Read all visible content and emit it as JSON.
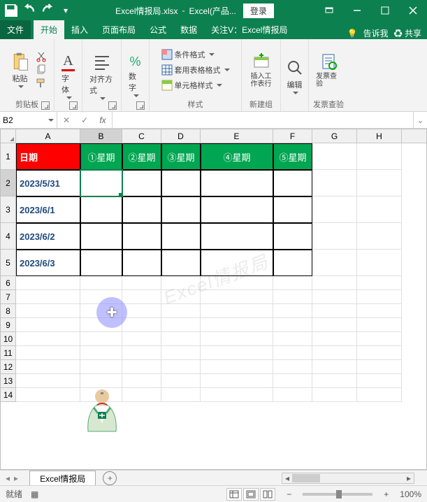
{
  "title_bar": {
    "filename": "Excel情报局.xlsx",
    "app": "Excel(产品...",
    "login": "登录"
  },
  "ribbon": {
    "tabs": {
      "file": "文件",
      "home": "开始",
      "insert": "插入",
      "layout": "页面布局",
      "formula": "公式",
      "data": "数据",
      "follow": "关注V：Excel情报局",
      "tellme": "告诉我",
      "share": "共享"
    },
    "groups": {
      "clipboard": {
        "label": "剪贴板",
        "paste": "粘贴"
      },
      "font": {
        "label": "字体"
      },
      "align": {
        "label": "对齐方式"
      },
      "number": {
        "label": "数字"
      },
      "styles": {
        "label": "样式",
        "cond": "条件格式",
        "table": "套用表格格式",
        "cell": "单元格样式"
      },
      "newgroup": {
        "label": "新建组",
        "insert_ws": "插入工作表行"
      },
      "editing": {
        "label": "编辑"
      },
      "invoice": {
        "label": "发票查验",
        "btn": "发票查验"
      }
    }
  },
  "namebox": "B2",
  "columns": [
    "A",
    "B",
    "C",
    "D",
    "E",
    "F",
    "G",
    "H"
  ],
  "table": {
    "headers": {
      "date": "日期",
      "w1": "①星期",
      "w2": "②星期",
      "w3": "③星期",
      "w4": "④星期",
      "w5": "⑤星期"
    },
    "rows": [
      {
        "date": "2023/5/31"
      },
      {
        "date": "2023/6/1"
      },
      {
        "date": "2023/6/2"
      },
      {
        "date": "2023/6/3"
      }
    ]
  },
  "watermark": "Excel情报局",
  "sheet_tab": "Excel情报局",
  "status": {
    "ready": "就绪",
    "zoom": "100%"
  }
}
